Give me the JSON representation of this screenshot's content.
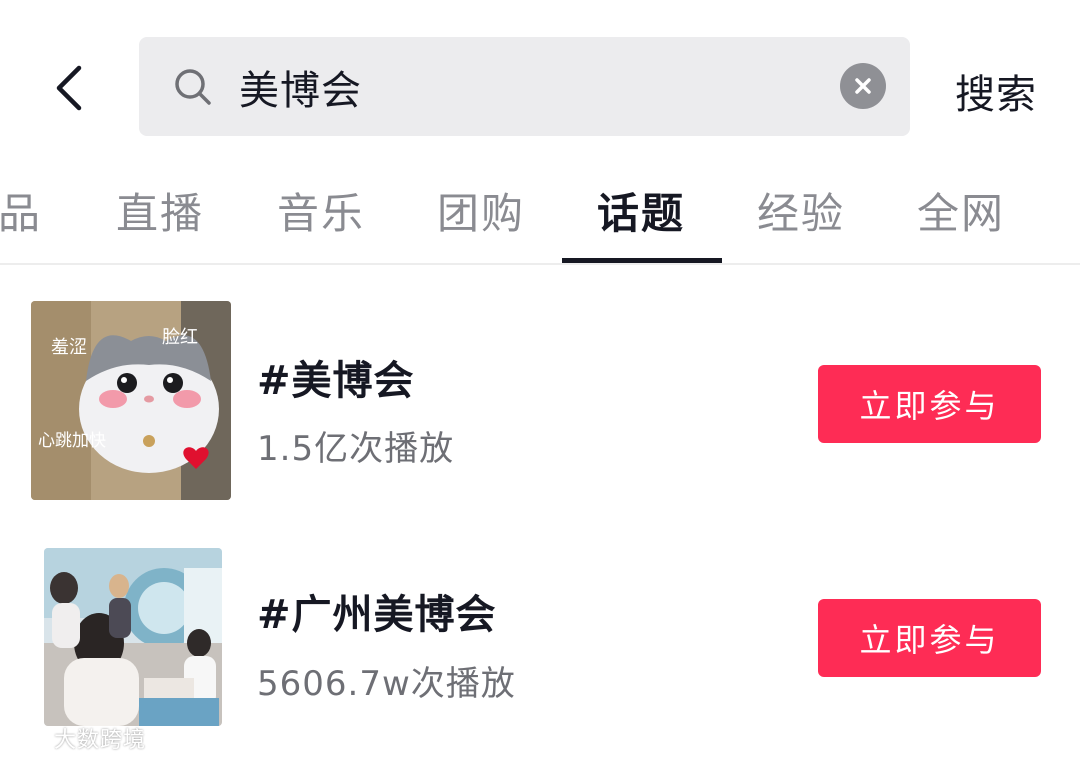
{
  "search": {
    "query": "美博会",
    "submit_label": "搜索"
  },
  "tabs": [
    {
      "label": "品",
      "active": false
    },
    {
      "label": "直播",
      "active": false
    },
    {
      "label": "音乐",
      "active": false
    },
    {
      "label": "团购",
      "active": false
    },
    {
      "label": "话题",
      "active": true
    },
    {
      "label": "经验",
      "active": false
    },
    {
      "label": "全网",
      "active": false
    }
  ],
  "results": [
    {
      "title": "#美博会",
      "plays": "1.5亿次播放",
      "button_label": "立即参与",
      "thumb_captions": {
        "shy": "羞涩",
        "blush": "脸红",
        "heartbeat": "心跳加快"
      }
    },
    {
      "title": "#广州美博会",
      "plays": "5606.7w次播放",
      "button_label": "立即参与"
    }
  ],
  "watermark": "大数跨境",
  "colors": {
    "accent": "#fe2c55",
    "text_primary": "#161823",
    "text_secondary": "#6e6f75",
    "tab_inactive": "#8a8b91",
    "search_bg": "#ececee"
  }
}
